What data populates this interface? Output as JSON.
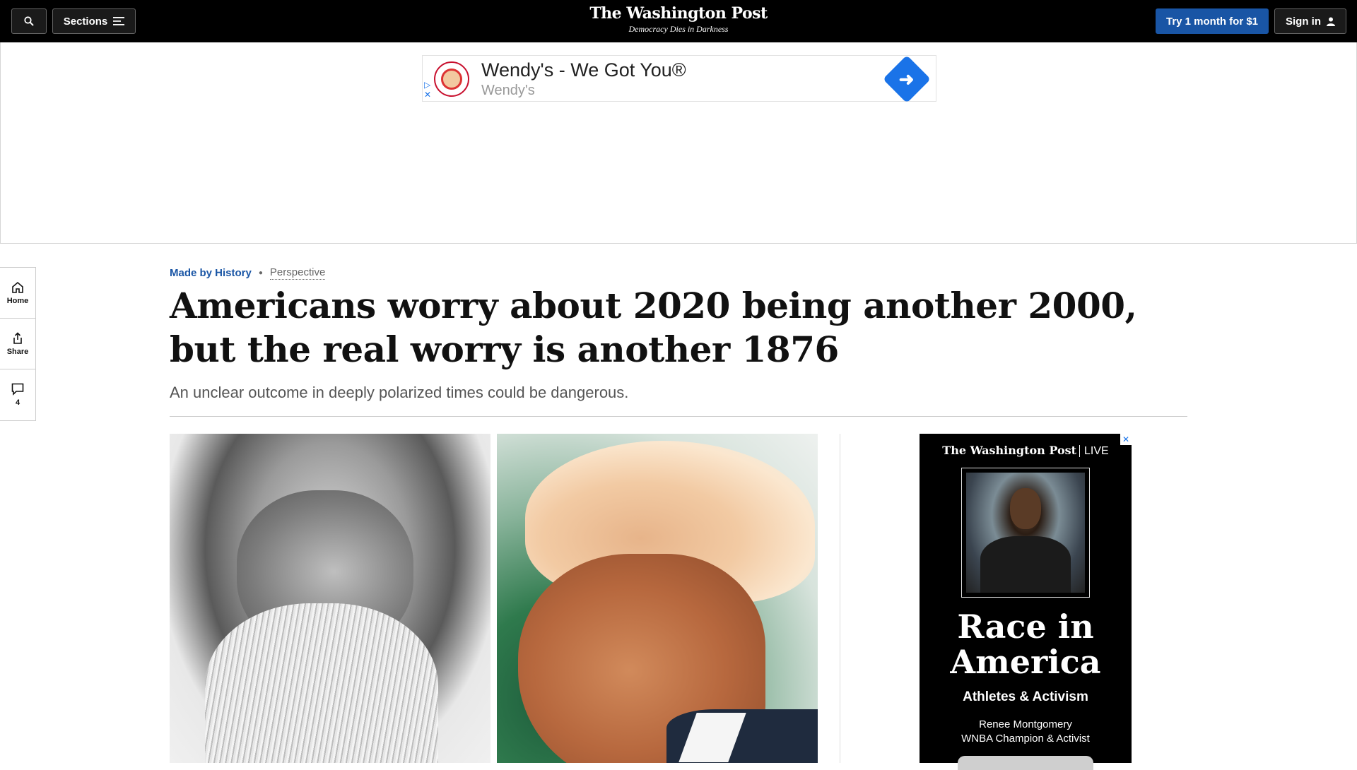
{
  "nav": {
    "sections_label": "Sections",
    "logo": "The Washington Post",
    "tagline": "Democracy Dies in Darkness",
    "subscribe_label": "Try 1 month for $1",
    "signin_label": "Sign in"
  },
  "top_ad": {
    "title": "Wendy's - We Got You®",
    "advertiser": "Wendy's"
  },
  "rail": {
    "home_label": "Home",
    "share_label": "Share",
    "comments_count": "4"
  },
  "article": {
    "section": "Made by History",
    "label": "Perspective",
    "headline": "Americans worry about 2020 being another 2000, but the real worry is another 1876",
    "dek": "An unclear outcome in deeply polarized times could be dangerous."
  },
  "side_ad": {
    "brand": "The Washington Post",
    "brand_suffix": "LIVE",
    "headline": "Race in America",
    "subtitle": "Athletes & Activism",
    "speaker_name": "Renee Montgomery",
    "speaker_title": "WNBA Champion & Activist"
  },
  "colors": {
    "nav_bg": "#000000",
    "accent": "#1955a5",
    "ad_arrow": "#1a73e8"
  }
}
